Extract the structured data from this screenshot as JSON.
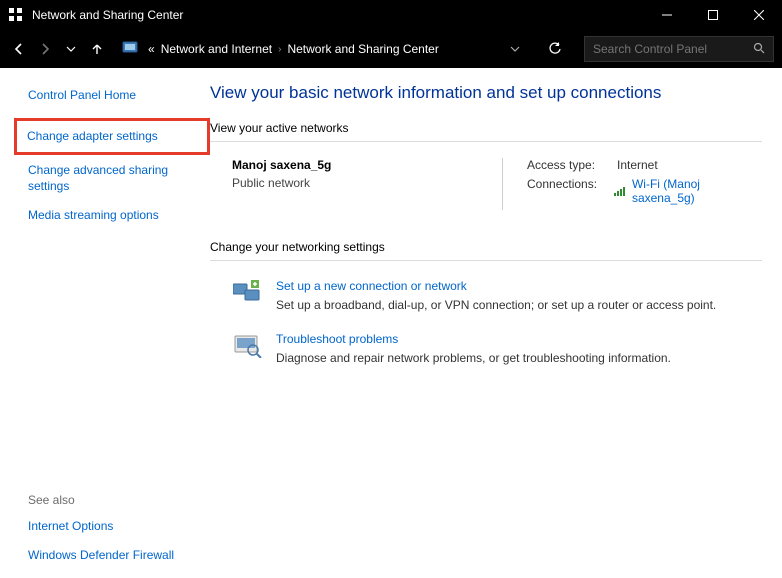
{
  "window": {
    "title": "Network and Sharing Center"
  },
  "breadcrumb": {
    "prefix": "«",
    "item1": "Network and Internet",
    "item2": "Network and Sharing Center"
  },
  "search": {
    "placeholder": "Search Control Panel"
  },
  "sidebar": {
    "home": "Control Panel Home",
    "adapter": "Change adapter settings",
    "advanced": "Change advanced sharing settings",
    "streaming": "Media streaming options",
    "see_also": "See also",
    "internet_options": "Internet Options",
    "firewall": "Windows Defender Firewall"
  },
  "main": {
    "title": "View your basic network information and set up connections",
    "active_h": "View your active networks",
    "network": {
      "name": "Manoj saxena_5g",
      "type": "Public network",
      "access_label": "Access type:",
      "access_value": "Internet",
      "conn_label": "Connections:",
      "conn_value": "Wi-Fi (Manoj saxena_5g)"
    },
    "change_h": "Change your networking settings",
    "task1": {
      "title": "Set up a new connection or network",
      "desc": "Set up a broadband, dial-up, or VPN connection; or set up a router or access point."
    },
    "task2": {
      "title": "Troubleshoot problems",
      "desc": "Diagnose and repair network problems, or get troubleshooting information."
    }
  }
}
